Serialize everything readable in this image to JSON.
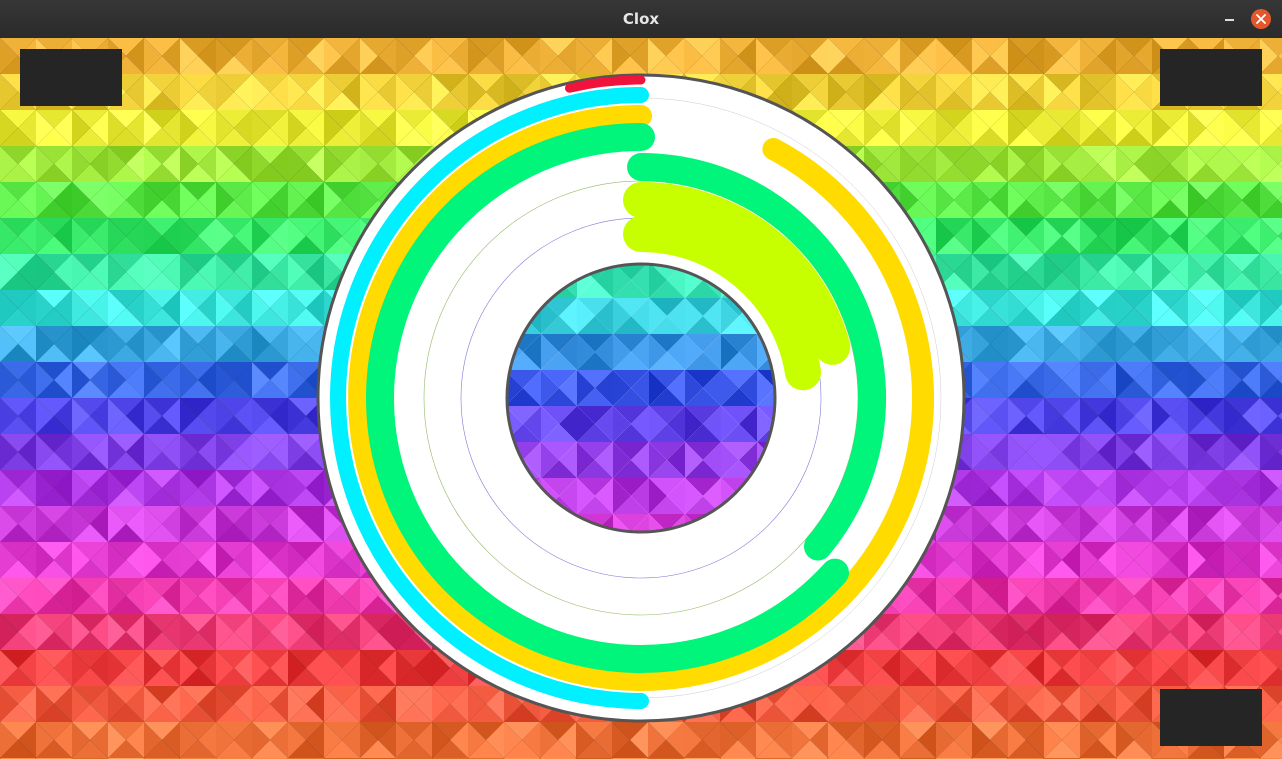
{
  "window": {
    "title": "Clox",
    "buttons": {
      "minimize_icon": "minimize-icon",
      "close_icon": "close-icon"
    }
  },
  "background": {
    "pattern": "rainbow-triangle-mosaic",
    "gradient": [
      "#f2a33a",
      "#eef03a",
      "#36e84a",
      "#3ee8e0",
      "#3848e8",
      "#b23ae8",
      "#f03ac8",
      "#f04040",
      "#f0803a"
    ]
  },
  "clock": {
    "face_color": "#ffffff",
    "rim_color": "#555555",
    "rings": [
      {
        "name": "red",
        "color": "#f0143c",
        "fraction": 0.04
      },
      {
        "name": "cyan",
        "color": "#00f0ff",
        "fraction": 0.5
      },
      {
        "name": "yellow",
        "color": "#ffdb00",
        "fraction": 0.97
      },
      {
        "name": "green",
        "color": "#00f57a",
        "fraction": 0.86
      },
      {
        "name": "lime",
        "color": "#c8ff00",
        "fraction": 0.22
      }
    ]
  },
  "colors": {
    "corner_box": "#252525",
    "title_text": "#e6e6e6",
    "close_button": "#e2582c"
  }
}
